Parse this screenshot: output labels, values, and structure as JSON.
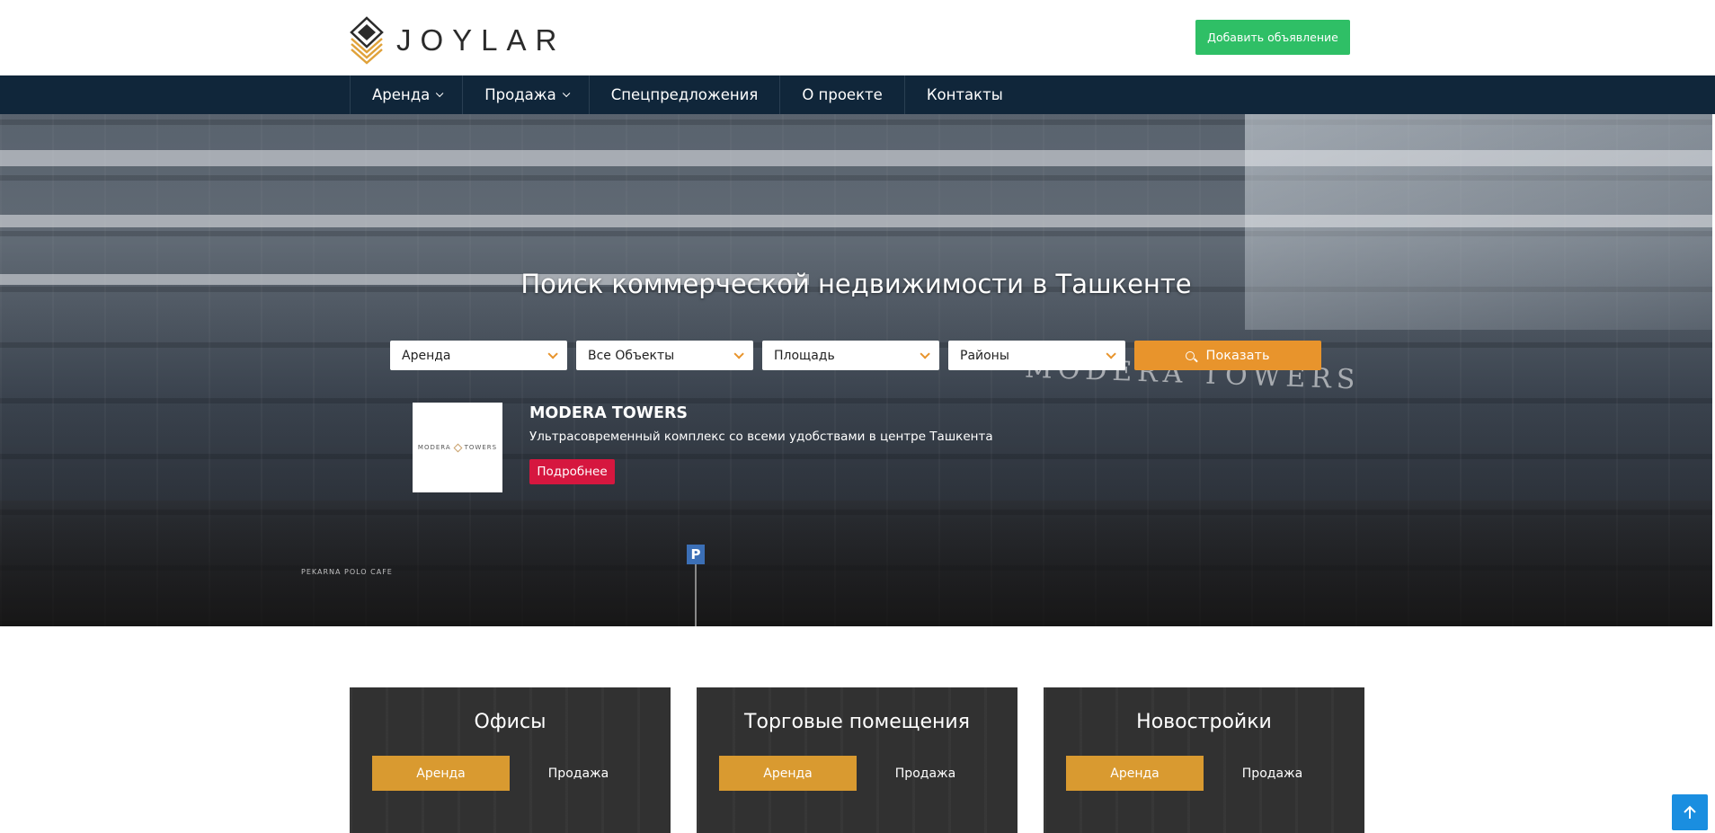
{
  "header": {
    "logo_text": "JOYLAR",
    "add_listing_label": "Добавить объявление"
  },
  "nav": {
    "items": [
      {
        "label": "Аренда",
        "has_dropdown": true
      },
      {
        "label": "Продажа",
        "has_dropdown": true
      },
      {
        "label": "Спецпредложения",
        "has_dropdown": false
      },
      {
        "label": "О проекте",
        "has_dropdown": false
      },
      {
        "label": "Контакты",
        "has_dropdown": false
      }
    ]
  },
  "hero": {
    "title": "Поиск коммерческой недвижимости в Ташкенте",
    "filters": [
      {
        "value": "Аренда"
      },
      {
        "value": "Все Объекты"
      },
      {
        "value": "Площадь"
      },
      {
        "value": "Районы"
      }
    ],
    "search_button_label": "Показать",
    "promo": {
      "logo_text_left": "MODERA",
      "logo_text_right": "TOWERS",
      "title": "MODERA TOWERS",
      "subtitle": "Ультрасовременный комплекс со всеми удобствами в центре Ташкента",
      "button_label": "Подробнее"
    }
  },
  "categories": [
    {
      "title": "Офисы",
      "rent_label": "Аренда",
      "sale_label": "Продажа"
    },
    {
      "title": "Торговые помещения",
      "rent_label": "Аренда",
      "sale_label": "Продажа"
    },
    {
      "title": "Новостройки",
      "rent_label": "Аренда",
      "sale_label": "Продажа"
    }
  ],
  "colors": {
    "nav_bg": "#10263a",
    "add_button": "#2fbf66",
    "accent_orange": "#e8942c",
    "promo_button": "#d6173f",
    "scroll_top": "#1a8ee0"
  },
  "icons": {
    "search": "search-icon",
    "dropdown": "chevron-down-icon",
    "scroll_top": "arrow-up-icon"
  }
}
